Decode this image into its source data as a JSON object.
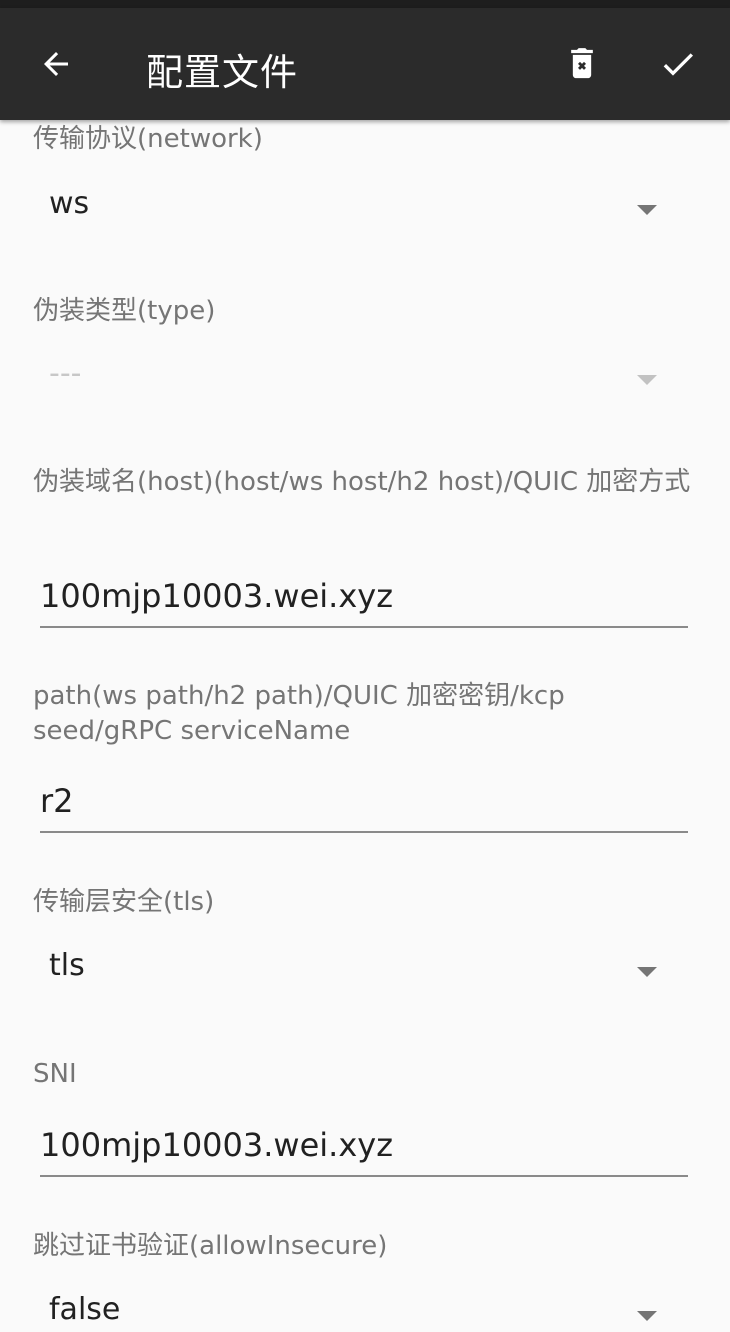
{
  "appbar": {
    "title": "配置文件",
    "back_icon": "arrow-back-icon",
    "delete_icon": "delete-icon",
    "save_icon": "check-icon",
    "background": "#2b2b2b"
  },
  "fields": {
    "network": {
      "label": "传输协议(network)",
      "value": "ws"
    },
    "type": {
      "label": "伪装类型(type)",
      "value": "---"
    },
    "host": {
      "label": "伪装域名(host)(host/ws host/h2 host)/QUIC 加密方式",
      "value": "100mjp10003.wei.xyz"
    },
    "path": {
      "label": "path(ws path/h2 path)/QUIC 加密密钥/kcp seed/gRPC serviceName",
      "value": "r2"
    },
    "tls": {
      "label": "传输层安全(tls)",
      "value": "tls"
    },
    "sni": {
      "label": "SNI",
      "value": "100mjp10003.wei.xyz"
    },
    "allow_insecure": {
      "label": "跳过证书验证(allowInsecure)",
      "value": "false"
    }
  }
}
